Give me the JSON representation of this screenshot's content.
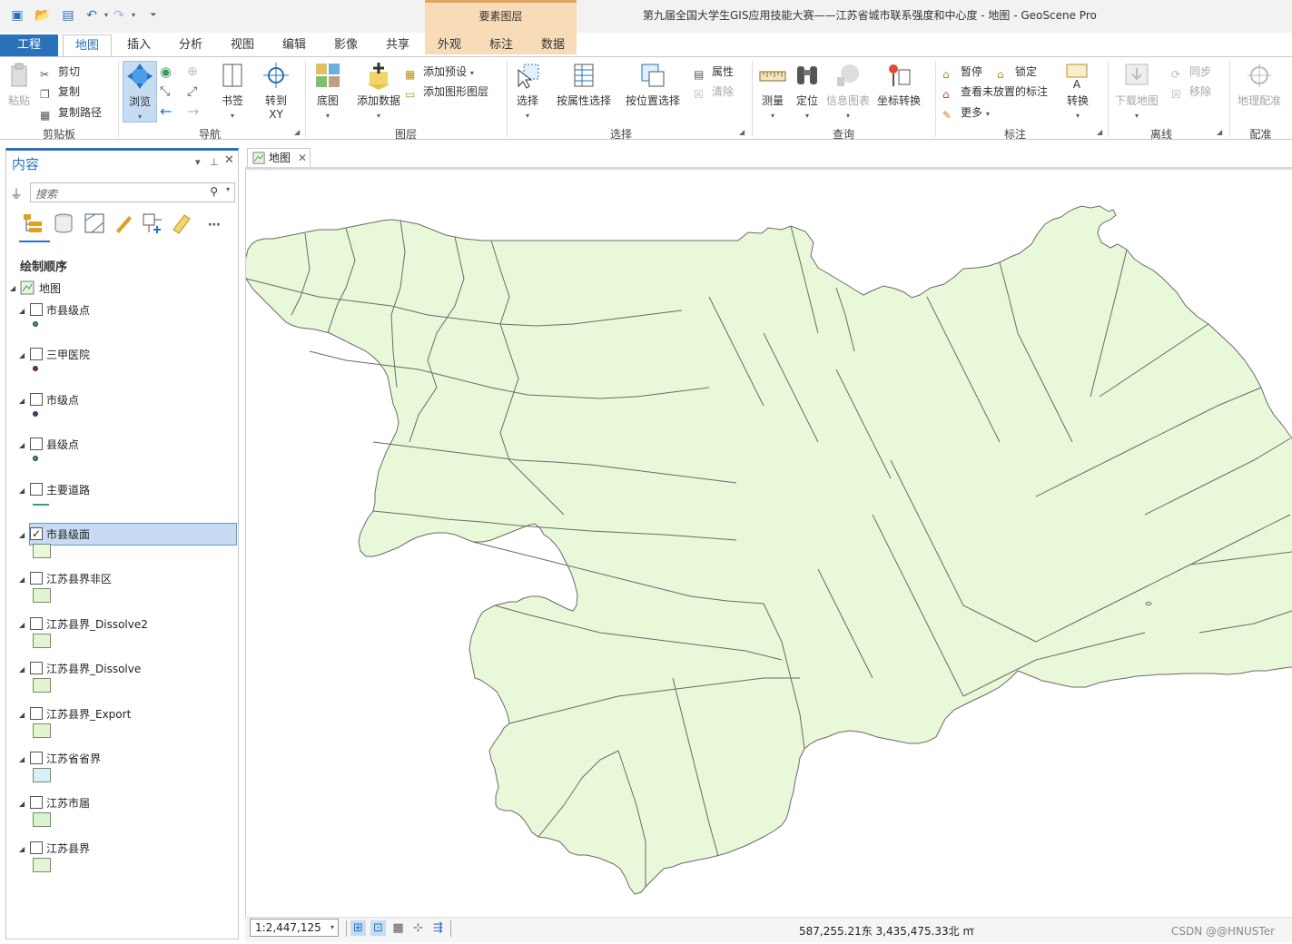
{
  "title": {
    "app_title": "第九届全国大学生GIS应用技能大赛——江苏省城市联系强度和中心度 - 地图 - GeoScene Pro",
    "context_tab_group": "要素图层"
  },
  "tabs": {
    "project": "工程",
    "map": "地图",
    "insert": "插入",
    "analysis": "分析",
    "view": "视图",
    "edit": "编辑",
    "imagery": "影像",
    "share": "共享",
    "appearance": "外观",
    "labeling": "标注",
    "data": "数据"
  },
  "ribbon": {
    "clipboard": {
      "group": "剪贴板",
      "paste": "粘贴",
      "cut": "剪切",
      "copy": "复制",
      "copy_path": "复制路径"
    },
    "navigate": {
      "group": "导航",
      "explore": "浏览",
      "bookmarks": "书签",
      "goto_xy_line1": "转到",
      "goto_xy_line2": "XY"
    },
    "layer": {
      "group": "图层",
      "basemap": "底图",
      "add_data": "添加数据",
      "add_preset": "添加预设",
      "add_graphics_layer": "添加图形图层"
    },
    "selection": {
      "group": "选择",
      "select": "选择",
      "select_by_attributes": "按属性选择",
      "select_by_location": "按位置选择",
      "attributes": "属性",
      "clear": "清除"
    },
    "inquiry": {
      "group": "查询",
      "measure": "测量",
      "locate": "定位",
      "infographics": "信息图表",
      "convert_coordinates": "坐标转换"
    },
    "labeling": {
      "group": "标注",
      "pause": "暂停",
      "lock": "锁定",
      "view_unplaced": "查看未放置的标注",
      "more": "更多",
      "convert": "转换"
    },
    "offline": {
      "group": "离线",
      "download_map": "下载地图",
      "sync": "同步",
      "remove": "移除"
    },
    "georeference": {
      "group": "配准",
      "georeference": "地理配准"
    }
  },
  "contents": {
    "title": "内容",
    "search_placeholder": "搜索",
    "drawing_order": "绘制顺序",
    "map_name": "地图",
    "layers": [
      {
        "name": "市县级点",
        "checked": false,
        "symbol": "point",
        "color": "#3a9a5a"
      },
      {
        "name": "三甲医院",
        "checked": false,
        "symbol": "point",
        "color": "#8a2a2a"
      },
      {
        "name": "市级点",
        "checked": false,
        "symbol": "point",
        "color": "#2a4a8a"
      },
      {
        "name": "县级点",
        "checked": false,
        "symbol": "point",
        "color": "#3a9a5a"
      },
      {
        "name": "主要道路",
        "checked": false,
        "symbol": "line",
        "color": "#3aa07a"
      },
      {
        "name": "市县级面",
        "checked": true,
        "symbol": "polygon",
        "color": "#e8f8d8"
      },
      {
        "name": "江苏县界非区",
        "checked": false,
        "symbol": "polygon",
        "color": "#e2f4d0"
      },
      {
        "name": "江苏县界_Dissolve2",
        "checked": false,
        "symbol": "polygon",
        "color": "#e2f4d0"
      },
      {
        "name": "江苏县界_Dissolve",
        "checked": false,
        "symbol": "polygon",
        "color": "#e2f4d0"
      },
      {
        "name": "江苏县界_Export",
        "checked": false,
        "symbol": "polygon",
        "color": "#e2f4d0"
      },
      {
        "name": "江苏省省界",
        "checked": false,
        "symbol": "polygon",
        "color": "#d8eefb"
      },
      {
        "name": "江苏市届",
        "checked": false,
        "symbol": "polygon",
        "color": "#d8f5d0"
      },
      {
        "name": "江苏县界",
        "checked": false,
        "symbol": "polygon",
        "color": "#e2f4d0"
      }
    ]
  },
  "map_view": {
    "tab_label": "地图",
    "fill_color": "#e8f8d8",
    "outline_color": "#6b6b6b"
  },
  "status": {
    "scale": "1:2,447,125",
    "coordinates": "587,255.21东 3,435,475.33北 m",
    "watermark": "CSDN @@HNUSTer"
  },
  "colors": {
    "accent": "#2a71b9",
    "context_tab": "#f8dcb8"
  }
}
